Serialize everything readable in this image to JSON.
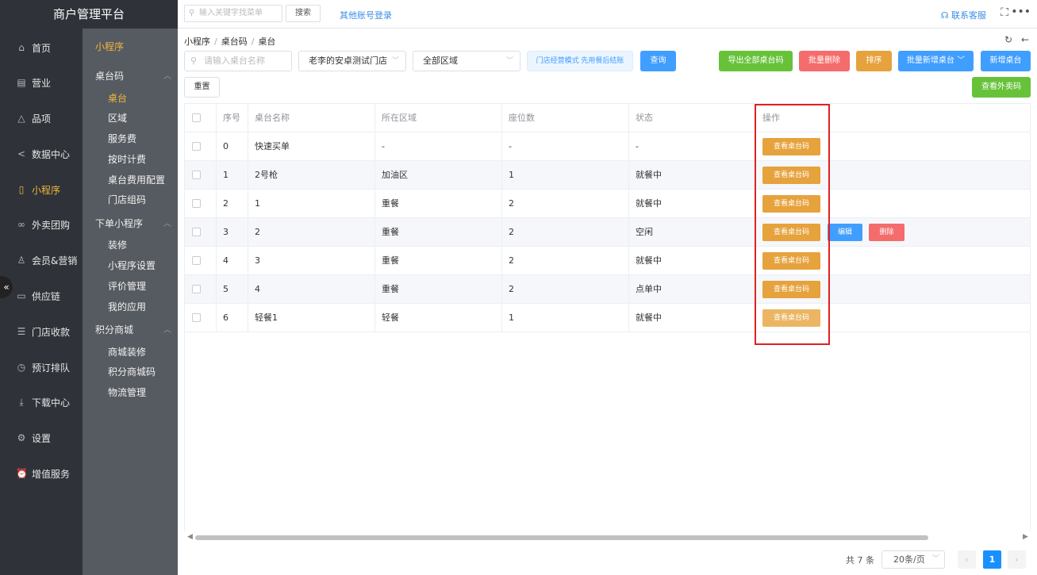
{
  "app": {
    "title": "商户管理平台"
  },
  "topbar": {
    "search_placeholder": "输入关键字找菜单",
    "search_button": "搜索",
    "other_login": "其他账号登录",
    "service": "联系客服"
  },
  "nav_main": [
    {
      "label": "首页",
      "icon": "home-icon",
      "glyph": "⌂"
    },
    {
      "label": "营业",
      "icon": "calendar-icon",
      "glyph": "▤"
    },
    {
      "label": "品项",
      "icon": "bag-icon",
      "glyph": "△"
    },
    {
      "label": "数据中心",
      "icon": "share-icon",
      "glyph": "<"
    },
    {
      "label": "小程序",
      "icon": "tablet-icon",
      "glyph": "▯"
    },
    {
      "label": "外卖团购",
      "icon": "bike-icon",
      "glyph": "∞"
    },
    {
      "label": "会员&营销",
      "icon": "user-icon",
      "glyph": "♙"
    },
    {
      "label": "供应链",
      "icon": "truck-icon",
      "glyph": "▭"
    },
    {
      "label": "门店收款",
      "icon": "coins-icon",
      "glyph": "☰"
    },
    {
      "label": "预订排队",
      "icon": "clock-icon",
      "glyph": "◷"
    },
    {
      "label": "下载中心",
      "icon": "download-icon",
      "glyph": "⤓"
    },
    {
      "label": "设置",
      "icon": "gear-icon",
      "glyph": "⚙"
    },
    {
      "label": "增值服务",
      "icon": "alarm-icon",
      "glyph": "⏰"
    }
  ],
  "nav_sub": {
    "title": "小程序",
    "groups": [
      {
        "label": "桌台码",
        "items": [
          "桌台",
          "区域",
          "服务费",
          "按时计费",
          "桌台费用配置",
          "门店组码"
        ]
      },
      {
        "label": "下单小程序",
        "items": [
          "装修",
          "小程序设置",
          "评价管理",
          "我的应用"
        ]
      },
      {
        "label": "积分商城",
        "items": [
          "商城装修",
          "积分商城码",
          "物流管理"
        ]
      }
    ]
  },
  "breadcrumb": [
    "小程序",
    "桌台码",
    "桌台"
  ],
  "filters": {
    "name_placeholder": "请输入桌台名称",
    "store": "老李的安卓测试门店",
    "area": "全部区域",
    "mode_tag": "门店经营模式 先用餐后结账",
    "query": "查询",
    "reset": "重置"
  },
  "actions": {
    "export": "导出全部桌台码",
    "batch_delete": "批量删除",
    "sort": "排序",
    "batch_add": "批量新增桌台",
    "add": "新增桌台",
    "view_takeout": "查看外卖码"
  },
  "colors": {
    "green": "#67c23a",
    "red": "#f56c6c",
    "orange": "#e6a23c",
    "blue": "#409eff",
    "sidebar_active": "#f0b63f"
  },
  "table": {
    "headers": [
      "序号",
      "桌台名称",
      "所在区域",
      "座位数",
      "状态",
      "操作"
    ],
    "rows": [
      {
        "no": "0",
        "name": "快速买单",
        "area": "-",
        "seats": "-",
        "status": "-"
      },
      {
        "no": "1",
        "name": "2号枪",
        "area": "加油区",
        "seats": "1",
        "status": "就餐中"
      },
      {
        "no": "2",
        "name": "1",
        "area": "重餐",
        "seats": "2",
        "status": "就餐中"
      },
      {
        "no": "3",
        "name": "2",
        "area": "重餐",
        "seats": "2",
        "status": "空闲"
      },
      {
        "no": "4",
        "name": "3",
        "area": "重餐",
        "seats": "2",
        "status": "就餐中"
      },
      {
        "no": "5",
        "name": "4",
        "area": "重餐",
        "seats": "2",
        "status": "点单中"
      },
      {
        "no": "6",
        "name": "轻餐1",
        "area": "轻餐",
        "seats": "1",
        "status": "就餐中"
      }
    ],
    "op_view": "查看桌台码",
    "op_edit": "编辑",
    "op_delete": "删除"
  },
  "pagination": {
    "total": "共 7 条",
    "page_size": "20条/页",
    "current": "1"
  }
}
